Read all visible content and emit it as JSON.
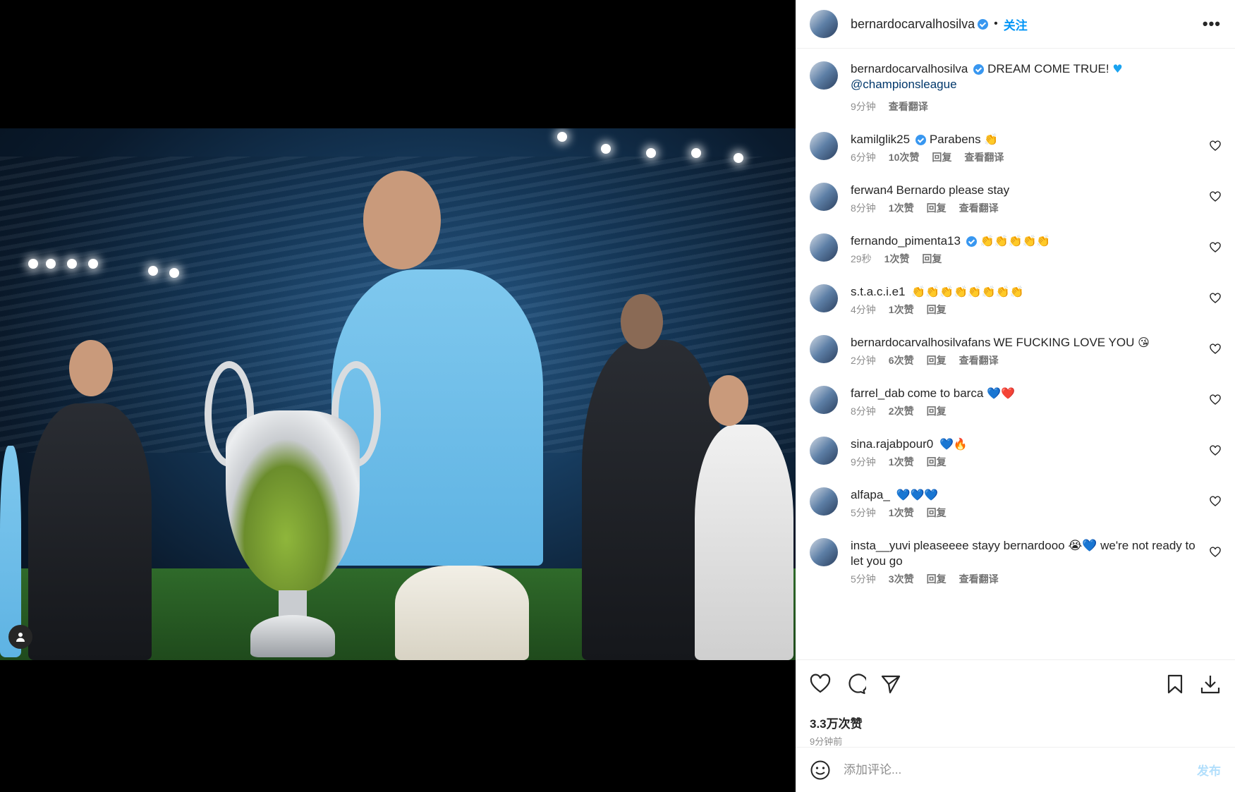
{
  "post": {
    "author": "bernardocarvalhosilva",
    "follow_label": "关注",
    "separator": "•",
    "more_label": "•••",
    "caption_author": "bernardocarvalhosilva",
    "caption_text": "DREAM COME TRUE!",
    "caption_mention": "@championsleague",
    "caption_time": "9分钟",
    "caption_translate": "查看翻译"
  },
  "comments": [
    {
      "user": "kamilglik25",
      "verified": true,
      "text": "Parabens",
      "emoji": "👏",
      "time": "6分钟",
      "likes": "10次赞",
      "reply": "回复",
      "translate": "查看翻译"
    },
    {
      "user": "ferwan4",
      "verified": false,
      "text": "Bernardo please stay",
      "emoji": "",
      "time": "8分钟",
      "likes": "1次赞",
      "reply": "回复",
      "translate": "查看翻译"
    },
    {
      "user": "fernando_pimenta13",
      "verified": true,
      "text": "",
      "emoji": "👏👏👏👏👏",
      "time": "29秒",
      "likes": "1次赞",
      "reply": "回复",
      "translate": ""
    },
    {
      "user": "s.t.a.c.i.e1",
      "verified": false,
      "text": "",
      "emoji": "👏👏👏👏👏👏👏👏",
      "time": "4分钟",
      "likes": "1次赞",
      "reply": "回复",
      "translate": ""
    },
    {
      "user": "bernardocarvalhosilvafans",
      "verified": false,
      "text": "WE FUCKING LOVE YOU",
      "emoji": "😘",
      "time": "2分钟",
      "likes": "6次赞",
      "reply": "回复",
      "translate": "查看翻译"
    },
    {
      "user": "farrel_dab",
      "verified": false,
      "text": "come to barca",
      "emoji": "💙❤️",
      "time": "8分钟",
      "likes": "2次赞",
      "reply": "回复",
      "translate": ""
    },
    {
      "user": "sina.rajabpour0",
      "verified": false,
      "text": "",
      "emoji": "💙🔥",
      "time": "9分钟",
      "likes": "1次赞",
      "reply": "回复",
      "translate": ""
    },
    {
      "user": "alfapa_",
      "verified": false,
      "text": "",
      "emoji": "💙💙💙",
      "time": "5分钟",
      "likes": "1次赞",
      "reply": "回复",
      "translate": ""
    },
    {
      "user": "insta__yuvi",
      "verified": false,
      "text": "pleaseeee stayy bernardooo 😭💙 we're not ready to let you go",
      "emoji": "",
      "time": "5分钟",
      "likes": "3次赞",
      "reply": "回复",
      "translate": "查看翻译"
    }
  ],
  "actions": {
    "likes_count": "3.3万次赞",
    "posted_ago": "9分钟前"
  },
  "compose": {
    "placeholder": "添加评论...",
    "post_label": "发布"
  },
  "colors": {
    "accent": "#0095f6",
    "verified": "#3897f0",
    "muted": "#8e8e8e"
  }
}
